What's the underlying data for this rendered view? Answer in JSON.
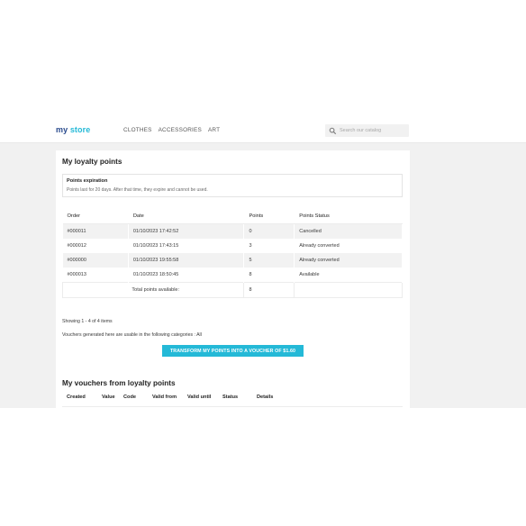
{
  "header": {
    "logo_main": "my",
    "logo_accent": "store",
    "nav": [
      "CLOTHES",
      "ACCESSORIES",
      "ART"
    ],
    "search_placeholder": "Search our catalog",
    "search_icon": "search-icon"
  },
  "main": {
    "title": "My loyalty points",
    "expiration": {
      "title": "Points expiration",
      "text": "Points last for 20 days. After that time, they expire and cannot be used."
    },
    "table": {
      "headers": [
        "Order",
        "Date",
        "Points",
        "Points Status"
      ],
      "rows": [
        [
          "#000011",
          "01/10/2023 17:42:52",
          "0",
          "Cancelled"
        ],
        [
          "#000012",
          "01/10/2023 17:43:15",
          "3",
          "Already converted"
        ],
        [
          "#000000",
          "01/10/2023 19:55:58",
          "5",
          "Already converted"
        ],
        [
          "#000013",
          "01/10/2023 18:50:45",
          "8",
          "Available"
        ]
      ],
      "total_label": "Total points available:",
      "total_value": "8"
    },
    "showing": "Showing 1 - 4 of 4 items",
    "voucher_note": "Vouchers generated here are usable in the following categories : All",
    "transform_button": "TRANSFORM MY POINTS INTO A VOUCHER OF $1.60",
    "vouchers": {
      "title": "My vouchers from loyalty points",
      "headers": [
        "Created",
        "Value",
        "Code",
        "Valid from",
        "Valid until",
        "Status",
        "Details"
      ]
    }
  }
}
